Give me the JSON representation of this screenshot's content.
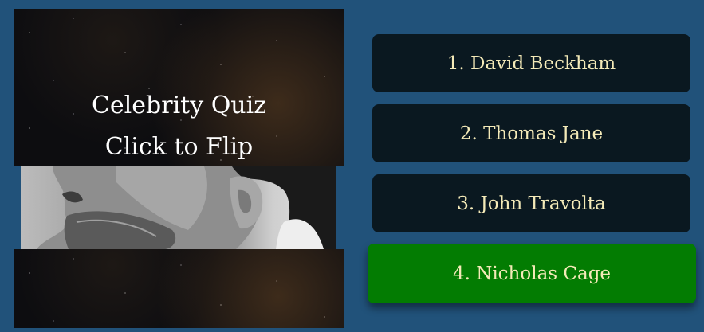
{
  "card": {
    "title_line1": "Celebrity Quiz",
    "title_line2": "Click to Flip"
  },
  "answers": [
    {
      "label": "1. David Beckham",
      "state": "default"
    },
    {
      "label": "2. Thomas Jane",
      "state": "default"
    },
    {
      "label": "3. John Travolta",
      "state": "default"
    },
    {
      "label": "4. Nicholas Cage",
      "state": "correct"
    }
  ],
  "colors": {
    "background": "#21527a",
    "answer_button": "#0a1820",
    "answer_text": "#f4eab8",
    "correct_button": "#037c02",
    "card_text": "#ffffff"
  }
}
